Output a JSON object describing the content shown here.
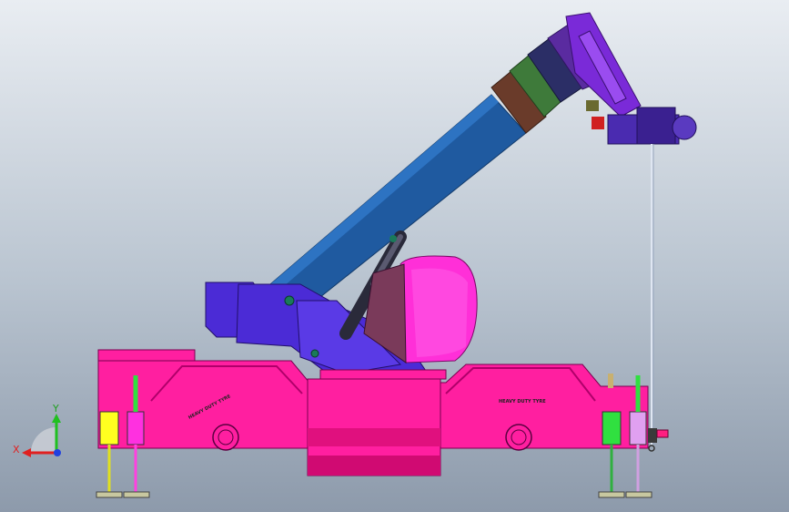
{
  "model": {
    "tyre_text_left": "HEAVY DUTY TYRE",
    "tyre_text_right": "HEAVY DUTY TYRE"
  },
  "triad": {
    "x_label": "X",
    "y_label": "Y",
    "x_color": "#e02020",
    "y_color": "#20c020",
    "z_color": "#2040e0"
  },
  "colors": {
    "chassis": "#ff1fa0",
    "boom": "#1f5aa0",
    "turret": "#4b2bd6",
    "cab": "#ff2fd8",
    "jib": "#7a2ad8"
  }
}
